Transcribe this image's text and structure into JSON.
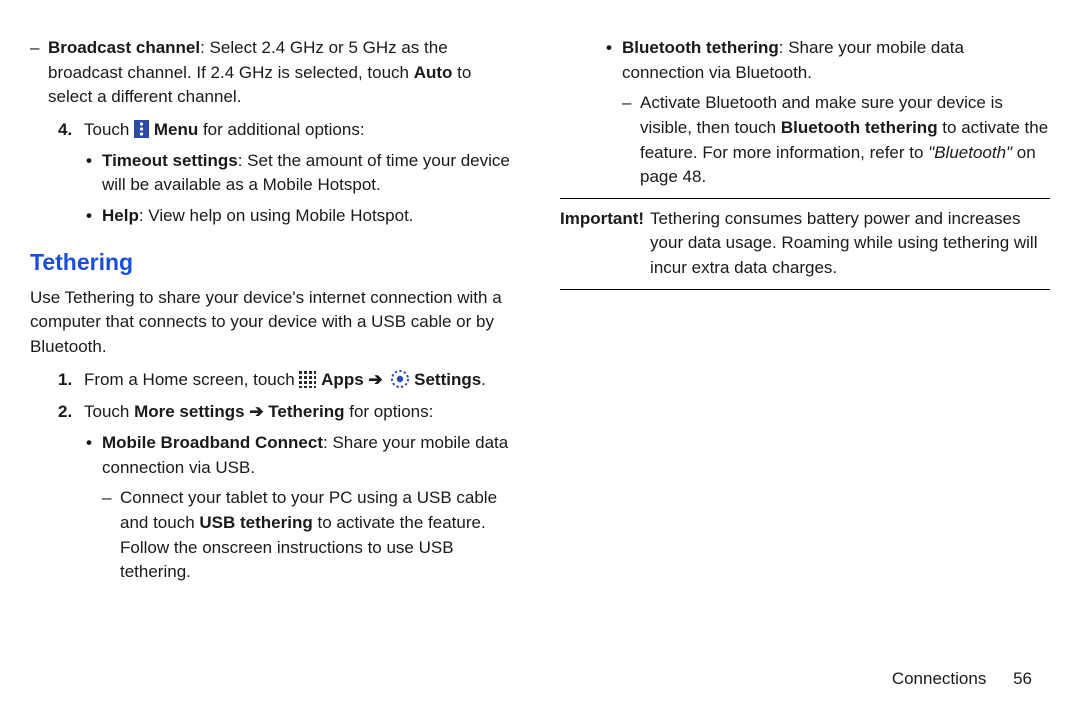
{
  "left": {
    "broadcast_channel_label": "Broadcast channel",
    "broadcast_channel_text": ": Select 2.4 GHz or 5 GHz as the broadcast channel. If 2.4 GHz is selected, touch ",
    "broadcast_channel_auto": "Auto",
    "broadcast_channel_tail": " to select a different channel.",
    "step4_num": "4.",
    "step4_a": "Touch ",
    "step4_menu": " Menu",
    "step4_b": " for additional options:",
    "timeout_label": "Timeout settings",
    "timeout_text": ": Set the amount of time your device will be available as a Mobile Hotspot.",
    "help_label": "Help",
    "help_text": ": View help on using Mobile Hotspot.",
    "tethering_heading": "Tethering",
    "tethering_intro": "Use Tethering to share your device's internet connection with a computer that connects to your device with a USB cable or by Bluetooth.",
    "step1_num": "1.",
    "step1_a": "From a Home screen, touch ",
    "step1_apps": " Apps ",
    "step1_arrow": "➔",
    "step1_settings": " Settings",
    "step1_period": ".",
    "step2_num": "2.",
    "step2_a": "Touch ",
    "step2_more": "More settings ➔ Tethering",
    "step2_b": " for options:",
    "mbc_label": "Mobile Broadband Connect",
    "mbc_text": ": Share your mobile data connection via USB.",
    "mbc_sub": "Connect your tablet to your PC using a USB cable and touch ",
    "mbc_sub_bold": "USB tethering",
    "mbc_sub_tail": " to activate the feature. Follow the onscreen instructions to use USB tethering."
  },
  "right": {
    "bt_label": "Bluetooth tethering",
    "bt_text": ": Share your mobile data connection via Bluetooth.",
    "bt_sub_a": "Activate Bluetooth and make sure your device is visible, then touch ",
    "bt_sub_bold": "Bluetooth tethering",
    "bt_sub_b": " to activate the feature. For more information, refer to ",
    "bt_sub_ref": "\"Bluetooth\"",
    "bt_sub_tail": " on page 48.",
    "important_label": "Important!",
    "important_text": " Tethering consumes battery power and increases your data usage. Roaming while using tethering will incur extra data charges."
  },
  "footer": {
    "section": "Connections",
    "page": "56"
  }
}
